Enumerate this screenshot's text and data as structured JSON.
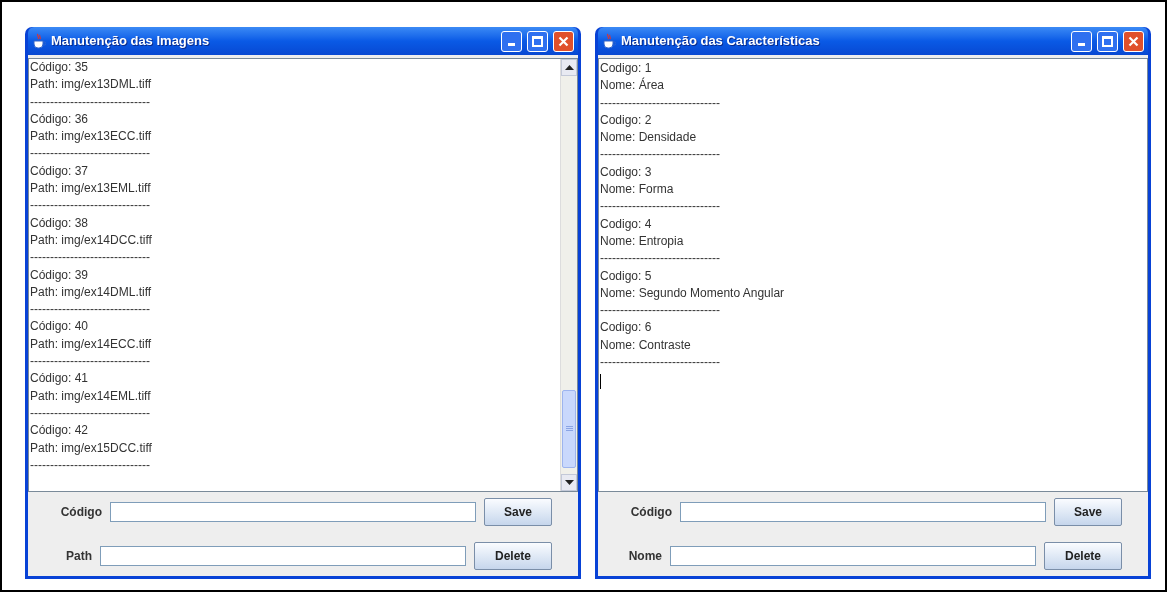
{
  "windows": [
    {
      "title": "Manutenção das Imagens",
      "scrollbar": true,
      "cursor": false,
      "lines": [
        "Código: 35",
        "Path: img/ex13DML.tiff",
        "------------------------------",
        "Código: 36",
        "Path: img/ex13ECC.tiff",
        "------------------------------",
        "Código: 37",
        "Path: img/ex13EML.tiff",
        "------------------------------",
        "Código: 38",
        "Path: img/ex14DCC.tiff",
        "------------------------------",
        "Código: 39",
        "Path: img/ex14DML.tiff",
        "------------------------------",
        "Código: 40",
        "Path: img/ex14ECC.tiff",
        "------------------------------",
        "Código: 41",
        "Path: img/ex14EML.tiff",
        "------------------------------",
        "Código: 42",
        "Path: img/ex15DCC.tiff",
        "------------------------------"
      ],
      "form": [
        {
          "label": "Código",
          "button": "Save"
        },
        {
          "label": "Path",
          "button": "Delete"
        }
      ]
    },
    {
      "title": "Manutenção das Características",
      "scrollbar": false,
      "cursor": true,
      "lines": [
        "Codigo: 1",
        "Nome: Área",
        "------------------------------",
        "Codigo: 2",
        "Nome: Densidade",
        "------------------------------",
        "Codigo: 3",
        "Nome: Forma",
        "------------------------------",
        "Codigo: 4",
        "Nome: Entropia",
        "------------------------------",
        "Codigo: 5",
        "Nome: Segundo Momento Angular",
        "------------------------------",
        "Codigo: 6",
        "Nome: Contraste",
        "------------------------------"
      ],
      "form": [
        {
          "label": "Código",
          "button": "Save"
        },
        {
          "label": "Nome",
          "button": "Delete"
        }
      ]
    }
  ]
}
